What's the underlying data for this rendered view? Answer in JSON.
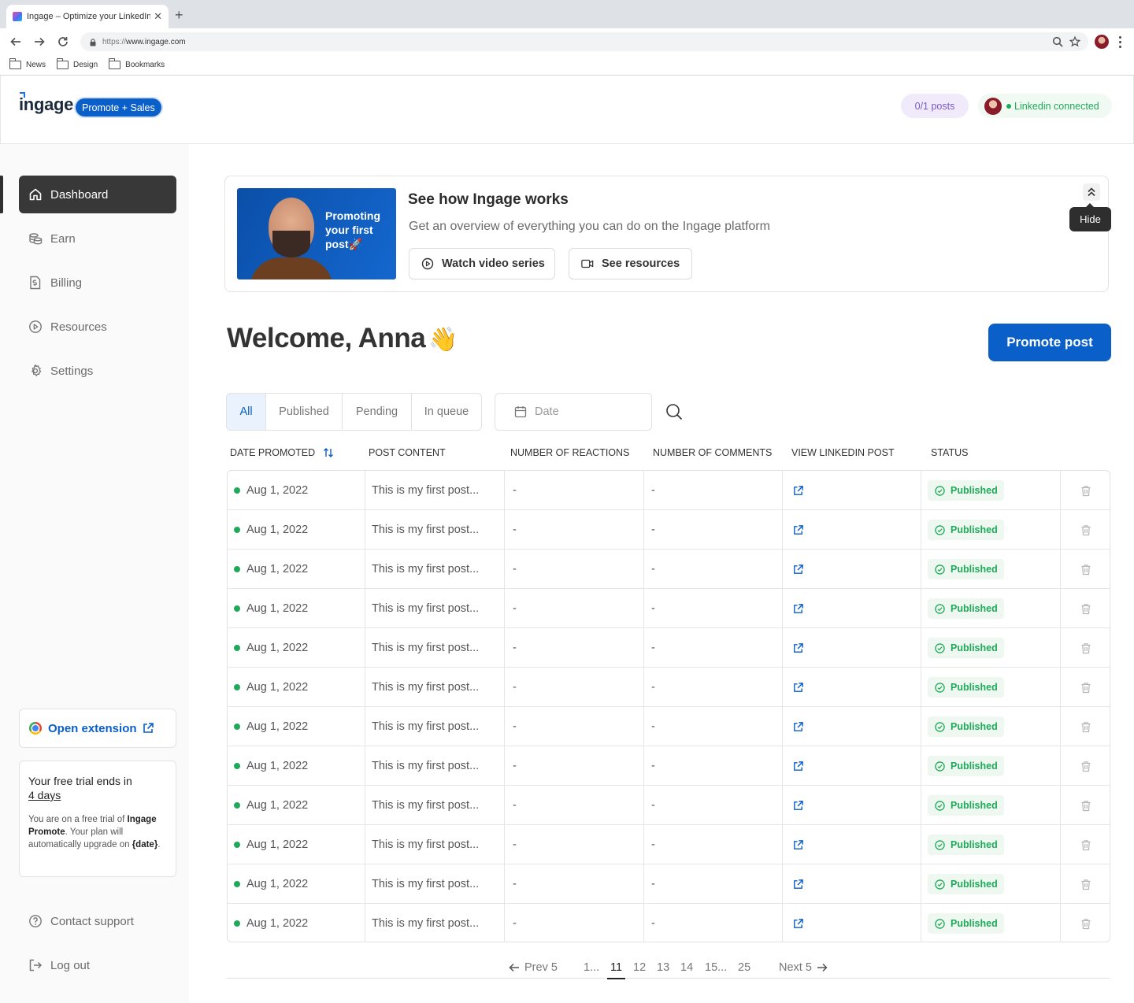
{
  "browser": {
    "tab_title": "Ingage – Optimize your LinkedIn",
    "url_scheme": "https://",
    "url_host": "www.ingage.com",
    "bookmarks": [
      "News",
      "Design",
      "Bookmarks"
    ]
  },
  "header": {
    "logo": "ingage",
    "plan_badge": "Promote + Sales",
    "posts_usage": "0/1 posts",
    "linkedin_status": "Linkedin connected"
  },
  "sidebar": {
    "items": [
      {
        "label": "Dashboard",
        "icon": "home-icon",
        "active": true
      },
      {
        "label": "Earn",
        "icon": "coins-icon"
      },
      {
        "label": "Billing",
        "icon": "billing-icon"
      },
      {
        "label": "Resources",
        "icon": "play-circle-icon"
      },
      {
        "label": "Settings",
        "icon": "gear-icon"
      }
    ],
    "extension_label": "Open extension",
    "trial": {
      "title": "Your free trial ends in",
      "days": "4 days",
      "body_1": "You are on a free trial of ",
      "plan_name": "Ingage Promote",
      "body_2": ". Your plan will automatically upgrade on ",
      "date_token": "{date}",
      "body_3": "."
    },
    "contact_support": "Contact support",
    "log_out": "Log out"
  },
  "banner": {
    "thumbnail_text": "Promoting your first post🚀",
    "title": "See how Ingage works",
    "subtitle": "Get an overview of everything you can do on the Ingage platform",
    "watch_label": "Watch video series",
    "resources_label": "See resources",
    "hide_tooltip": "Hide"
  },
  "main": {
    "welcome": "Welcome, Anna",
    "wave": "👋",
    "promote_button": "Promote post",
    "filters": [
      "All",
      "Published",
      "Pending",
      "In queue"
    ],
    "date_placeholder": "Date"
  },
  "table": {
    "columns": [
      "DATE PROMOTED",
      "POST CONTENT",
      "NUMBER OF REACTIONS",
      "NUMBER OF COMMENTS",
      "VIEW LINKEDIN POST",
      "STATUS"
    ],
    "rows": [
      {
        "date": "Aug 1, 2022",
        "content": "This is my first post...",
        "reactions": "-",
        "comments": "-",
        "status": "Published"
      },
      {
        "date": "Aug 1, 2022",
        "content": "This is my first post...",
        "reactions": "-",
        "comments": "-",
        "status": "Published"
      },
      {
        "date": "Aug 1, 2022",
        "content": "This is my first post...",
        "reactions": "-",
        "comments": "-",
        "status": "Published"
      },
      {
        "date": "Aug 1, 2022",
        "content": "This is my first post...",
        "reactions": "-",
        "comments": "-",
        "status": "Published"
      },
      {
        "date": "Aug 1, 2022",
        "content": "This is my first post...",
        "reactions": "-",
        "comments": "-",
        "status": "Published"
      },
      {
        "date": "Aug 1, 2022",
        "content": "This is my first post...",
        "reactions": "-",
        "comments": "-",
        "status": "Published"
      },
      {
        "date": "Aug 1, 2022",
        "content": "This is my first post...",
        "reactions": "-",
        "comments": "-",
        "status": "Published"
      },
      {
        "date": "Aug 1, 2022",
        "content": "This is my first post...",
        "reactions": "-",
        "comments": "-",
        "status": "Published"
      },
      {
        "date": "Aug 1, 2022",
        "content": "This is my first post...",
        "reactions": "-",
        "comments": "-",
        "status": "Published"
      },
      {
        "date": "Aug 1, 2022",
        "content": "This is my first post...",
        "reactions": "-",
        "comments": "-",
        "status": "Published"
      },
      {
        "date": "Aug 1, 2022",
        "content": "This is my first post...",
        "reactions": "-",
        "comments": "-",
        "status": "Published"
      },
      {
        "date": "Aug 1, 2022",
        "content": "This is my first post...",
        "reactions": "-",
        "comments": "-",
        "status": "Published"
      }
    ]
  },
  "pagination": {
    "prev": "Prev 5",
    "pages": [
      "1...",
      "11",
      "12",
      "13",
      "14",
      "15...",
      "25"
    ],
    "current": "11",
    "next": "Next 5"
  },
  "colors": {
    "brand_blue": "#0b5fc8",
    "success_green": "#1faa59",
    "sidebar_active": "#383838"
  }
}
